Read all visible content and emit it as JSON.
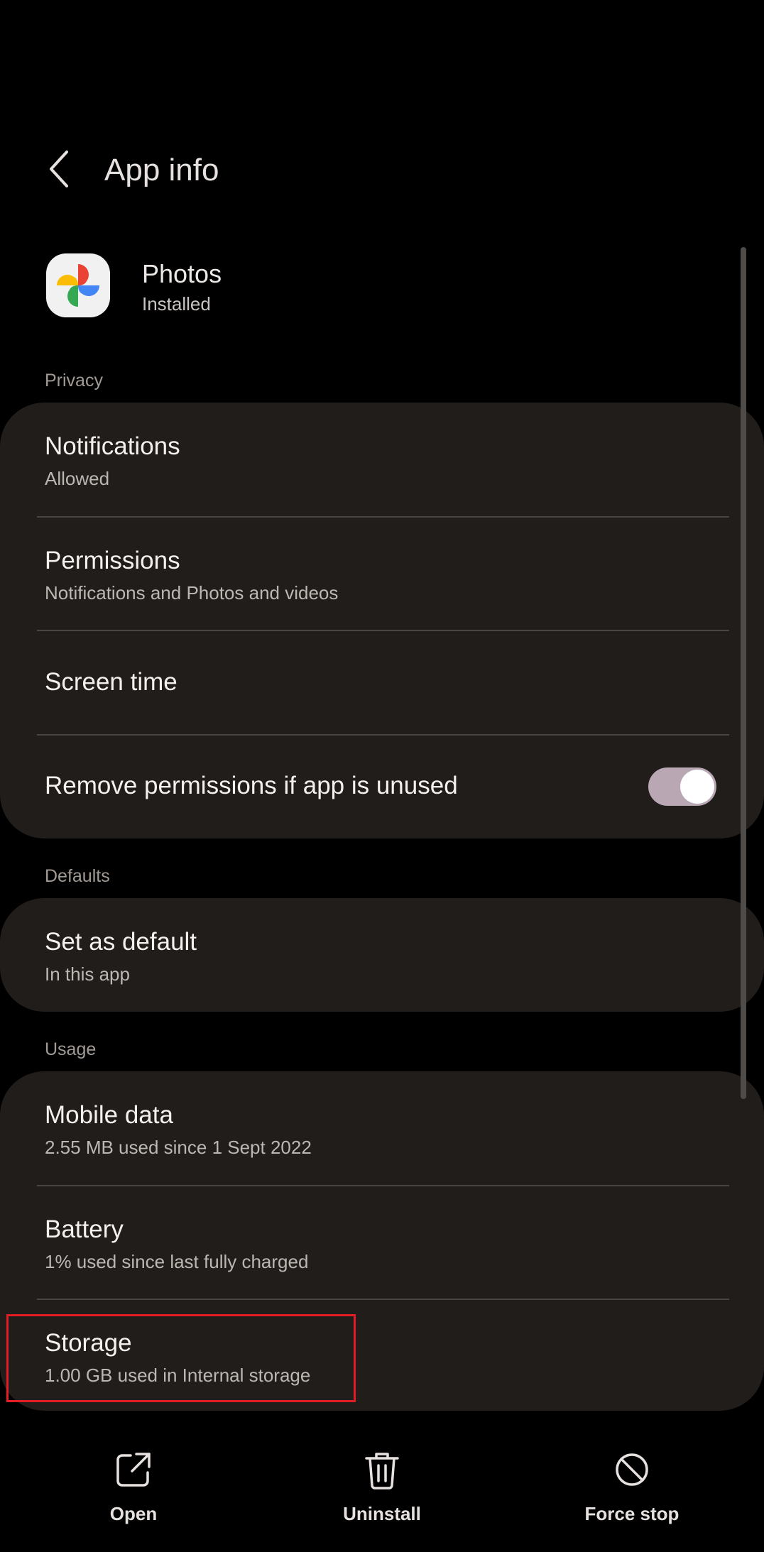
{
  "header": {
    "title": "App info"
  },
  "app": {
    "name": "Photos",
    "status": "Installed"
  },
  "sections": {
    "privacy": "Privacy",
    "defaults": "Defaults",
    "usage": "Usage"
  },
  "privacy_items": {
    "notifications": {
      "title": "Notifications",
      "subtitle": "Allowed"
    },
    "permissions": {
      "title": "Permissions",
      "subtitle": "Notifications and Photos and videos"
    },
    "screen_time": {
      "title": "Screen time"
    },
    "remove_permissions": {
      "title": "Remove permissions if app is unused",
      "toggle_on": true
    }
  },
  "defaults_items": {
    "set_default": {
      "title": "Set as default",
      "subtitle": "In this app"
    }
  },
  "usage_items": {
    "mobile_data": {
      "title": "Mobile data",
      "subtitle": "2.55 MB used since 1 Sept 2022"
    },
    "battery": {
      "title": "Battery",
      "subtitle": "1% used since last fully charged"
    },
    "storage": {
      "title": "Storage",
      "subtitle": "1.00 GB used in Internal storage"
    }
  },
  "actions": {
    "open": "Open",
    "uninstall": "Uninstall",
    "force_stop": "Force stop"
  },
  "colors": {
    "background": "#000000",
    "card": "#201d1a",
    "toggle_track": "#b9a8b4",
    "highlight": "#e21d26"
  }
}
